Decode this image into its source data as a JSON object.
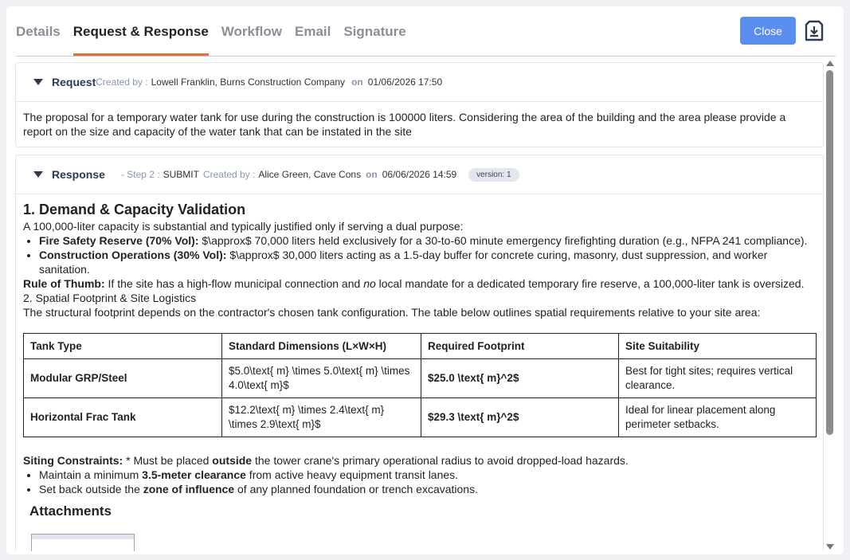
{
  "tabs": [
    "Details",
    "Request & Response",
    "Workflow",
    "Email",
    "Signature"
  ],
  "close_label": "Close",
  "request": {
    "title": "Request",
    "created_by_label": "Created by :",
    "author": "Lowell Franklin, Burns Construction Company",
    "on_label": "on",
    "date": "01/06/2026 17:50",
    "body": "The proposal for a temporary water tank for use during the construction is 100000 liters. Considering the area of the building and the area please provide a report on the size and capacity of the water tank that can be instated in the site"
  },
  "response": {
    "title": "Response",
    "step": "- Step 2 :",
    "step_name": "SUBMIT",
    "created_by_label": "Created by :",
    "author": "Alice Green, Cave Cons",
    "on_label": "on",
    "date": "06/06/2026 14:59",
    "version": "version: 1",
    "heading": "1. Demand & Capacity Validation",
    "intro": "A 100,000-liter capacity is substantial and typically justified only if serving a dual purpose:",
    "bullet1_bold": "Fire Safety Reserve (70% Vol):",
    "bullet1_text": " $\\approx$ 70,000 liters held exclusively for a 30-to-60 minute emergency firefighting duration (e.g., NFPA 241 compliance).",
    "bullet2_bold": "Construction Operations (30% Vol):",
    "bullet2_text": " $\\approx$ 30,000 liters acting as a 1.5-day buffer for concrete curing, masonry, dust suppression, and worker sanitation.",
    "rule_bold": "Rule of Thumb:",
    "rule_text_a": " If the site has a high-flow municipal connection and ",
    "rule_em": "no",
    "rule_text_b": " local mandate for a dedicated temporary fire reserve, a 100,000-liter tank is oversized.",
    "spatial_heading": "2. Spatial Footprint & Site Logistics",
    "spatial_text": "The structural footprint depends on the contractor's chosen tank configuration. The table below outlines spatial requirements relative to your site area:",
    "table": {
      "headers": [
        "Tank Type",
        "Standard Dimensions (L×W×H)",
        "Required Footprint",
        "Site Suitability"
      ],
      "rows": [
        [
          "Modular GRP/Steel",
          "$5.0\\text{ m} \\times 5.0\\text{ m} \\times 4.0\\text{ m}$",
          "$25.0 \\text{ m}^2$",
          "Best for tight sites; requires vertical clearance."
        ],
        [
          "Horizontal Frac Tank",
          "$12.2\\text{ m} \\times 2.4\\text{ m} \\times 2.9\\text{ m}$",
          "$29.3 \\text{ m}^2$",
          "Ideal for linear placement along perimeter setbacks."
        ]
      ]
    },
    "siting_bold": "Siting Constraints:",
    "siting_text_a": " * Must be placed ",
    "siting_outside": "outside",
    "siting_text_b": " the tower crane's primary operational radius to avoid dropped-load hazards.",
    "c1_a": "Maintain a minimum ",
    "c1_bold": "3.5-meter clearance",
    "c1_b": " from active heavy equipment transit lanes.",
    "c2_a": "Set back outside the ",
    "c2_bold": "zone of influence",
    "c2_b": " of any planned foundation or trench excavations.",
    "attachments_title": "Attachments"
  },
  "icons": {
    "download": "download-icon",
    "collapse": "collapse-triangle-icon"
  }
}
